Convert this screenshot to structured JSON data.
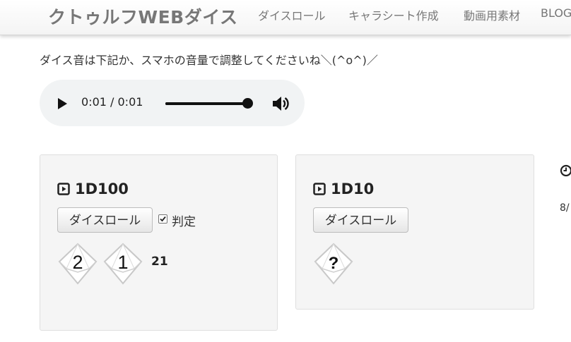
{
  "header": {
    "brand": "クトゥルフWEBダイス",
    "nav": [
      "ダイスロール",
      "キャラシート作成",
      "動画用素材",
      "BLOG"
    ]
  },
  "notice": "ダイス音は下記か、スマホの音量で調整してくださいね＼(^o^)／",
  "audio": {
    "time": "0:01 / 0:01",
    "progress": 1.0
  },
  "panels": [
    {
      "title": "1D100",
      "button": "ダイスロール",
      "checkbox_label": "判定",
      "checkbox_checked": true,
      "dice": [
        "2",
        "1"
      ],
      "total": "21"
    },
    {
      "title": "1D10",
      "button": "ダイスロール",
      "dice": [
        "?"
      ]
    }
  ],
  "side": {
    "text": "8/"
  },
  "icons": {
    "play": "play-icon",
    "volume": "volume-icon",
    "title": "play-square-icon",
    "clock": "clock-icon",
    "die": "d10-die-icon",
    "check": "checkmark-icon"
  }
}
